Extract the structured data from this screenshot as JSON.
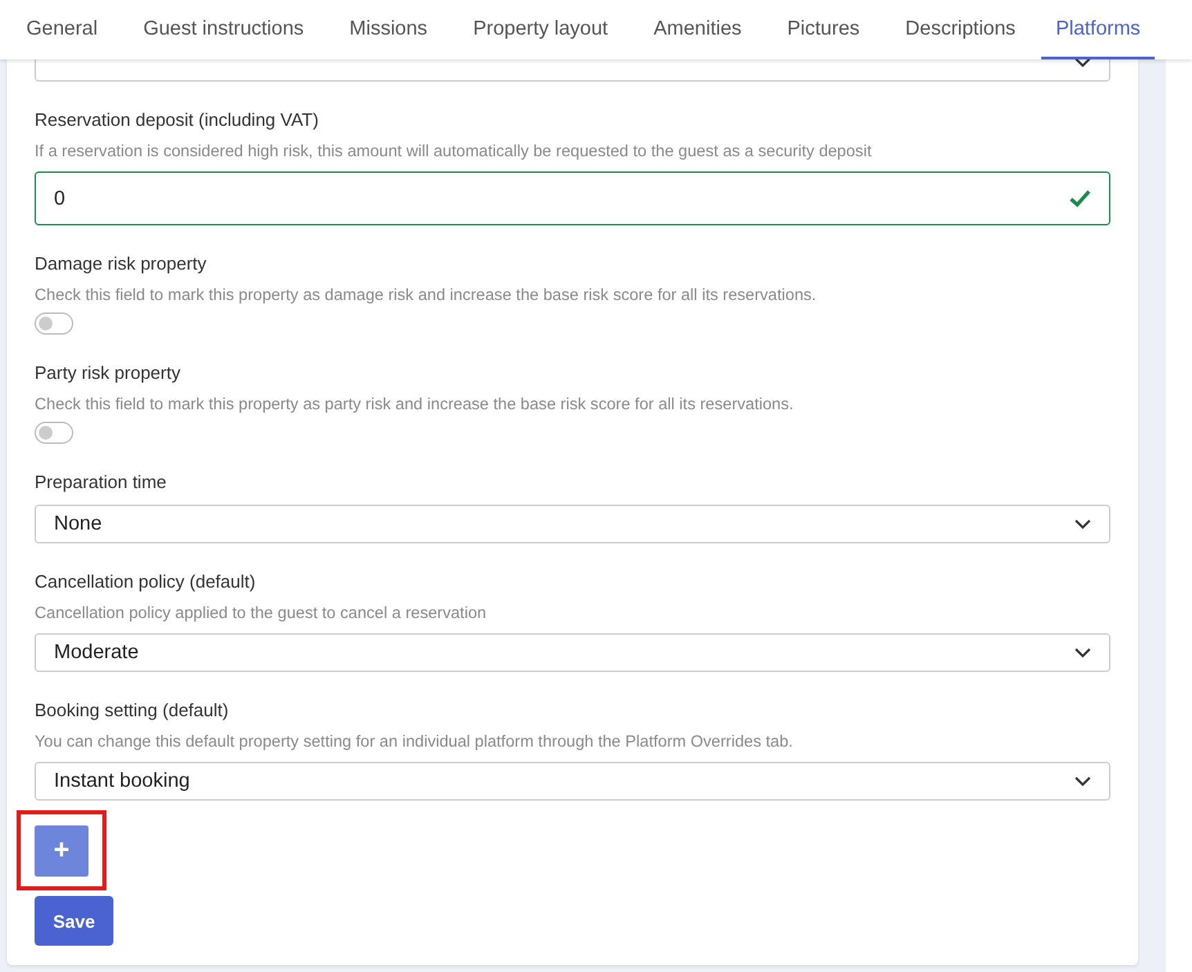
{
  "tabs": [
    {
      "label": "General",
      "selected": false
    },
    {
      "label": "Guest instructions",
      "selected": false
    },
    {
      "label": "Missions",
      "selected": false
    },
    {
      "label": "Property layout",
      "selected": false
    },
    {
      "label": "Amenities",
      "selected": false
    },
    {
      "label": "Pictures",
      "selected": false
    },
    {
      "label": "Descriptions",
      "selected": false
    },
    {
      "label": "Platforms",
      "selected": true
    }
  ],
  "fields": [
    {
      "kind": "input",
      "label": "Reservation deposit (including VAT)",
      "help": "If a reservation is considered high risk, this amount will automatically be requested to the guest as a security deposit",
      "value": "0",
      "valid": true
    },
    {
      "kind": "toggle",
      "label": "Damage risk property",
      "help": "Check this field to mark this property as damage risk and increase the base risk score for all its reservations.",
      "on": false
    },
    {
      "kind": "toggle",
      "label": "Party risk property",
      "help": "Check this field to mark this property as party risk and increase the base risk score for all its reservations.",
      "on": false
    },
    {
      "kind": "select",
      "label": "Preparation time",
      "value": "None"
    },
    {
      "kind": "select",
      "label": "Cancellation policy (default)",
      "help": "Cancellation policy applied to the guest to cancel a reservation",
      "value": "Moderate"
    },
    {
      "kind": "select",
      "label": "Booking setting (default)",
      "help": "You can change this default property setting for an individual platform through the Platform Overrides tab.",
      "value": "Instant booking"
    }
  ],
  "add_button": {
    "label": "+",
    "highlighted": true
  },
  "save_button": {
    "label": "Save"
  }
}
